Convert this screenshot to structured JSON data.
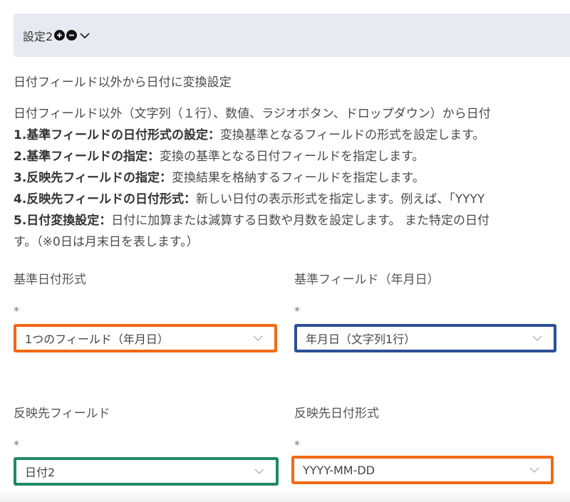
{
  "header": {
    "title": "設定2"
  },
  "section": {
    "title": "日付フィールド以外から日付に変換設定",
    "intro": "日付フィールド以外（文字列（１行）、数値、ラジオボタン、ドロップダウン）から日付",
    "items": [
      {
        "label": "1.基準フィールドの日付形式の設定：",
        "text": "変換基準となるフィールドの形式を設定します。"
      },
      {
        "label": "2.基準フィールドの指定：",
        "text": "変換の基準となる日付フィールドを指定します。"
      },
      {
        "label": "3.反映先フィールドの指定：",
        "text": "変換結果を格納するフィールドを指定します。"
      },
      {
        "label": "4.反映先フィールドの日付形式：",
        "text": "新しい日付の表示形式を指定します。例えば、「YYYY"
      },
      {
        "label": "5.日付変換設定：",
        "text": "日付に加算または減算する日数や月数を設定します。 また特定の日付"
      }
    ],
    "tail": "す。（※0日は月末日を表します。）"
  },
  "fields": {
    "base_format": {
      "label": "基準日付形式",
      "required": "*",
      "value": "1つのフィールド（年月日）",
      "border": "#f26a12"
    },
    "base_field": {
      "label": "基準フィールド（年月日）",
      "required": "*",
      "value": "年月日（文字列1行）",
      "border": "#2d4f96"
    },
    "target_field": {
      "label": "反映先フィールド",
      "required": "*",
      "value": "日付2",
      "border": "#1e8a63"
    },
    "target_format": {
      "label": "反映先日付形式",
      "required": "*",
      "value": "YYYY-MM-DD",
      "border": "#f26a12"
    }
  }
}
